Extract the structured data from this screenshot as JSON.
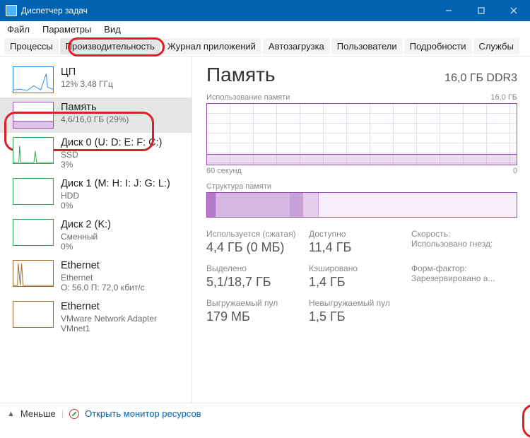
{
  "window": {
    "title": "Диспетчер задач"
  },
  "menu": {
    "file": "Файл",
    "options": "Параметры",
    "view": "Вид"
  },
  "tabs": {
    "processes": "Процессы",
    "performance": "Производительность",
    "app_history": "Журнал приложений",
    "startup": "Автозагрузка",
    "users": "Пользователи",
    "details": "Подробности",
    "services": "Службы"
  },
  "sidebar": {
    "cpu": {
      "title": "ЦП",
      "sub": "12% 3,48 ГГц"
    },
    "memory": {
      "title": "Память",
      "sub": "4,6/16,0 ГБ (29%)"
    },
    "disk0": {
      "title": "Диск 0 (U: D: E: F: C:)",
      "sub1": "SSD",
      "sub2": "3%"
    },
    "disk1": {
      "title": "Диск 1 (M: H: I: J: G: L:)",
      "sub1": "HDD",
      "sub2": "0%"
    },
    "disk2": {
      "title": "Диск 2 (K:)",
      "sub1": "Сменный",
      "sub2": "0%"
    },
    "eth0": {
      "title": "Ethernet",
      "sub1": "Ethernet",
      "sub2": "О: 56,0 П: 72,0 кбит/с"
    },
    "eth1": {
      "title": "Ethernet",
      "sub1": "VMware Network Adapter VMnet1"
    }
  },
  "main": {
    "title": "Память",
    "spec": "16,0 ГБ DDR3",
    "usage_label": "Использование памяти",
    "usage_max": "16,0 ГБ",
    "axis_left": "60 секунд",
    "axis_right": "0",
    "compo_label": "Структура памяти",
    "stats": {
      "inuse": {
        "lbl": "Используется (сжатая)",
        "val": "4,4 ГБ (0 МБ)"
      },
      "avail": {
        "lbl": "Доступно",
        "val": "11,4 ГБ"
      },
      "speed": {
        "lbl": "Скорость:",
        "val": ""
      },
      "slots": {
        "lbl": "Использовано гнезд:",
        "val": ""
      },
      "committed": {
        "lbl": "Выделено",
        "val": "5,1/18,7 ГБ"
      },
      "cached": {
        "lbl": "Кэшировано",
        "val": "1,4 ГБ"
      },
      "formfactor": {
        "lbl": "Форм-фактор:",
        "val": ""
      },
      "reserved": {
        "lbl": "Зарезервировано а...",
        "val": ""
      },
      "paged": {
        "lbl": "Выгружаемый пул",
        "val": "179 МБ"
      },
      "nonpaged": {
        "lbl": "Невыгружаемый пул",
        "val": "1,5 ГБ"
      }
    }
  },
  "footer": {
    "less": "Меньше",
    "link": "Открыть монитор ресурсов"
  },
  "chart_data": {
    "type": "area",
    "title": "Использование памяти",
    "ylabel": "ГБ",
    "ylim": [
      0,
      16.0
    ],
    "xlabel": "секунд",
    "xlim": [
      60,
      0
    ],
    "series": [
      {
        "name": "Память",
        "approx_value": 4.6,
        "percent": 29
      }
    ]
  }
}
